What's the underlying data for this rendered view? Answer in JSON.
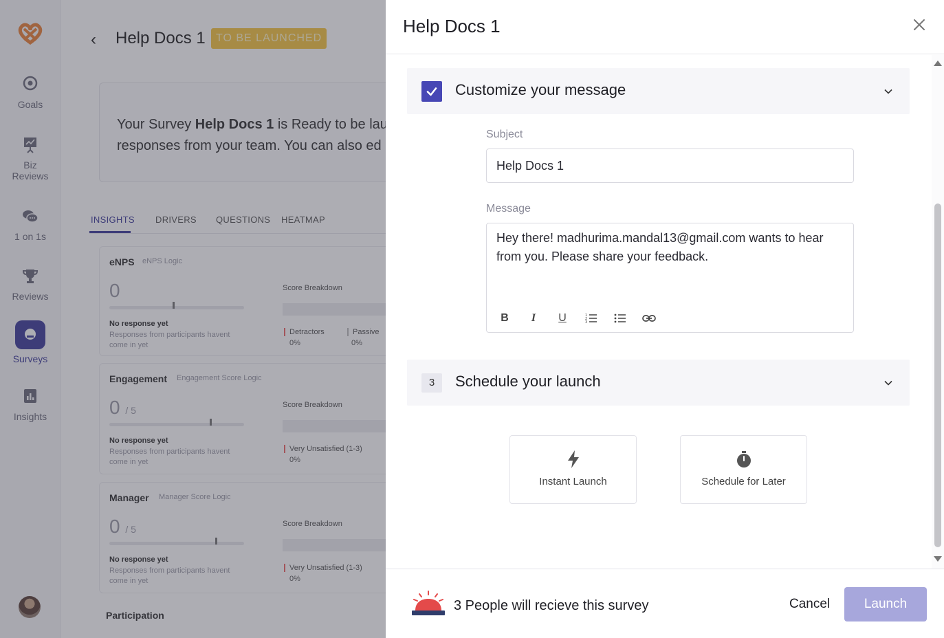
{
  "colors": {
    "accent": "#4747b5",
    "badge": "#f5c542",
    "launch_disabled": "#a7a7dc"
  },
  "sidebar": {
    "items": [
      {
        "label": "Goals",
        "icon": "target-icon"
      },
      {
        "label": "Biz\nReviews",
        "icon": "presentation-icon"
      },
      {
        "label": "1 on 1s",
        "icon": "chat-bubbles-icon"
      },
      {
        "label": "Reviews",
        "icon": "trophy-icon"
      },
      {
        "label": "Surveys",
        "icon": "survey-icon",
        "active": true
      },
      {
        "label": "Insights",
        "icon": "bar-chart-icon"
      }
    ]
  },
  "background": {
    "title": "Help Docs 1",
    "status": "TO BE LAUNCHED",
    "ready_pre": "Your Survey ",
    "ready_name": "Help Docs 1",
    "ready_post": " is Ready to be lau",
    "ready_line2": "responses from your team. You can also ed",
    "tabs": [
      "INSIGHTS",
      "DRIVERS",
      "QUESTIONS",
      "HEATMAP"
    ],
    "metrics": [
      {
        "name": "eNPS",
        "logic": "eNPS Logic",
        "score": "0",
        "max": "",
        "breakdown": "Score Breakdown",
        "no_response": "No response yet",
        "hint": "Responses from participants havent come in yet",
        "legend1": "Detractors",
        "pct1": "0%",
        "legend2": "Passive",
        "pct2": "0%"
      },
      {
        "name": "Engagement",
        "logic": "Engagement Score Logic",
        "score": "0",
        "max": "/ 5",
        "breakdown": "Score Breakdown",
        "no_response": "No response yet",
        "hint": "Responses from participants havent come in yet",
        "legend1": "Very Unsatisfied (1-3)",
        "pct1": "0%",
        "legend2": "",
        "pct2": ""
      },
      {
        "name": "Manager",
        "logic": "Manager Score Logic",
        "score": "0",
        "max": "/ 5",
        "breakdown": "Score Breakdown",
        "no_response": "No response yet",
        "hint": "Responses from participants havent come in yet",
        "legend1": "Very Unsatisfied (1-3)",
        "pct1": "0%",
        "legend2": "",
        "pct2": ""
      }
    ],
    "participation": "Participation"
  },
  "drawer": {
    "title": "Help Docs 1",
    "close_icon": "close-icon",
    "customize": {
      "title": "Customize your message",
      "subject_label": "Subject",
      "subject_value": "Help Docs 1",
      "message_label": "Message",
      "message_value": "Hey there! madhurima.mandal13@gmail.com wants to hear from you. Please share your feedback."
    },
    "schedule": {
      "step": "3",
      "title": "Schedule your launch",
      "instant_label": "Instant Launch",
      "later_label": "Schedule for Later"
    },
    "footer": {
      "recipients": "3 People will recieve this survey",
      "cancel": "Cancel",
      "launch": "Launch"
    }
  }
}
